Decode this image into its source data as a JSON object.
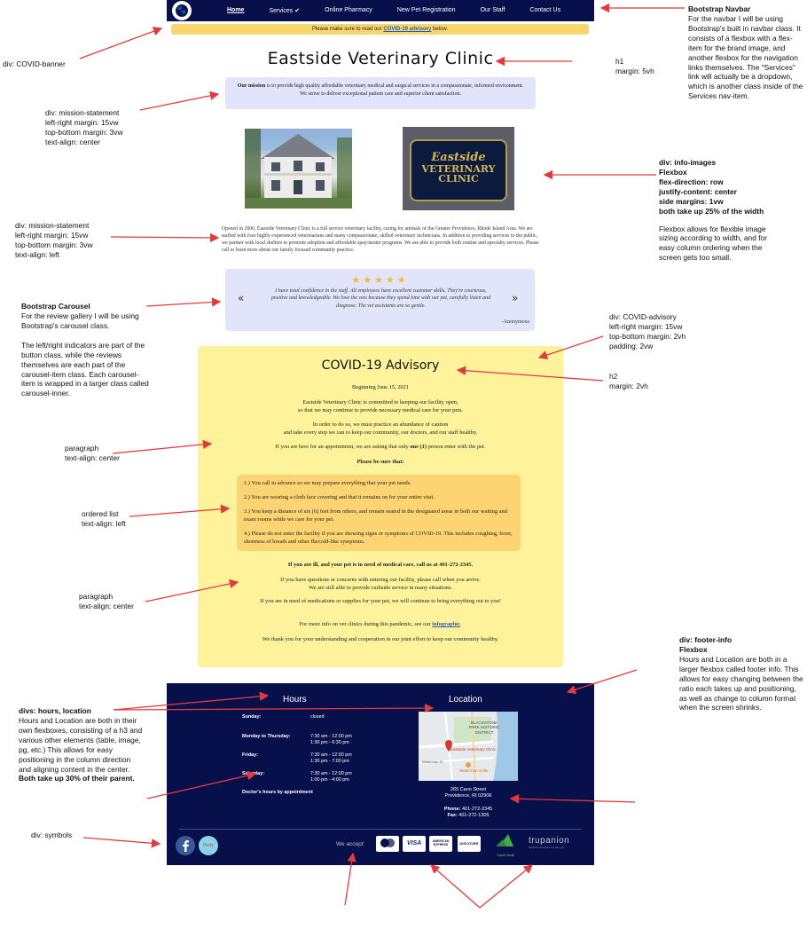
{
  "navbar": {
    "links": [
      "Home",
      "Services ✔",
      "Online Pharmacy",
      "New Pet Registration",
      "Our Staff",
      "Contact Us"
    ]
  },
  "covid_banner": {
    "text_before": "Please make sure to read our ",
    "link": "COVID-19 advisory",
    "text_after": " below."
  },
  "h1": "Eastside Veterinary Clinic",
  "mission": {
    "strong": "Our mission",
    "text": " is to provide high quality affordable veterinary medical and surgical services in a compassionate, informed environment. We strive to deliver exceptional patient care and superior client satisfaction."
  },
  "sign": {
    "line1": "Eastside",
    "line2": "VETERINARY",
    "line3": "CLINIC"
  },
  "about": "Opened in 2000, Eastside Veterinary Clinic is a full service veterinary facility, caring for animals of the Greater Providence, Rhode Island Area. We are staffed with four highly experienced veterinarians and many compassionate, skilled veterinary technicians. In addition to providing services to the public, we partner with local shelters to promote adoption and affordable spay/neuter programs. We are able to provide both routine and specialty services. Please call to learn more about our family focused  community practice.",
  "carousel": {
    "stars": "★★★★★",
    "rating": 5,
    "review": "I have total confidence in the staff. All employees have excellent customer skills. They're courteous, positive and knowledgeable. We love the vets because they spend time with our pet, carefully listen and diagnose. The vet assistants are so gentle.",
    "author": "-Anonymous",
    "prev": "«",
    "next": "»"
  },
  "advisory": {
    "h2": "COVID-19 Advisory",
    "date": "Beginning June 15, 2021",
    "p1a": "Eastside Veterinary Clinic is committed to keeping our facility open,",
    "p1b": "so that we may continue to provide necessary medical care for your pets.",
    "p2a": "In order to do so, we must practice an abundance of caution",
    "p2b": "and take every step we can to keep our community, our doctors, and our staff healthy.",
    "p3_before": "If you are here for an appointment, we are asking that only ",
    "p3_bold": "one (1)",
    "p3_after": " person enter with the pet.",
    "sure": "Please be sure that:",
    "list": [
      "1.) You call in advance so we may prepare everything that your pet needs.",
      "2.) You are wearing a cloth face covering and that it remains on for your entire visit.",
      "3.) You keep a distance of six (6) feet from others, and remain seated in the designated areas in both our waiting and exam rooms while we care for your pet.",
      "4.) Please do not enter the facility if you are showing signs or symptoms of COVID-19. This includes coughing, fever, shortness of  breath and other flu/cold-like symptoms."
    ],
    "ill": "If you are ill, and your pet is in need of medical care, call us at 401-272-2345.",
    "p5a": "If you have questions or concerns with entering our facility, please call when you arrive.",
    "p5b": "We are still able to provide curbside service in many situations.",
    "p6": "If you are in need of medications or supplies for your pet, we will continue to bring everything out to you!",
    "p7_before": "For more info on vet clinics during this pandemic, see our ",
    "p7_link": "infographic",
    "p7_after": ".",
    "p8": "We thank you for your understanding and cooperation in our joint effort to keep our community healthy."
  },
  "footer": {
    "hours_title": "Hours",
    "location_title": "Location",
    "hours": [
      {
        "day": "Sunday:",
        "time": "closed"
      },
      {
        "day": "Monday to Thursday:",
        "time": "7:30 am - 12:00 pm\n1:30 pm - 6:30 pm"
      },
      {
        "day": "Friday:",
        "time": "7:30 am - 12:00 pm\n1:30 pm - 7:00 pm"
      },
      {
        "day": "Saturday:",
        "time": "7:30 am - 12:00 pm\n1:00 pm - 4:00 pm"
      },
      {
        "day": "Doctor's hours by appointment",
        "time": ""
      }
    ],
    "map_labels": {
      "district": "BLACKSTONE\nPARK HISTORIC\nDISTRICT",
      "pin": "Eastside Veterinary Clinic",
      "other": "Waterman Grille",
      "road": "Waterman St"
    },
    "address1": "265 Cano Street",
    "address2": "Providence, RI  02906",
    "phone_label": "Phone:",
    "phone": " 401-272-2345",
    "fax_label": "Fax:",
    "fax": " 401-272-1305",
    "social_petly": "Petly",
    "we_accept": "We accept:",
    "cards": [
      "mastercard",
      "VISA",
      "AMERICAN EXPRESS",
      "DISCOVER"
    ],
    "carecredit": "CareCredit",
    "trupanion": "trupanion",
    "trupanion_sub": "Medical insurance for your pet"
  },
  "annotations": {
    "navbar_head": "Bootstrap Navbar",
    "navbar_body": "For the navbar I will be using Bootstrap's built in navbar class. It consists of a flexbox with a flex-item for the brand image, and another flexbox for the navigation links themselves. The \"Services\" link will actually be a dropdown, which is another class inside of the Services nav-item.",
    "covid_banner": "div: COVID-banner",
    "h1_a": "h1",
    "h1_b": "margin: 5vh",
    "mission1": [
      "div: mission-statement",
      "left-right margin: 15vw",
      "top-bottom margin: 3vw",
      "text-align: center"
    ],
    "info_images": [
      "div: info-images",
      "Flexbox",
      "flex-direction: row",
      "justify-content: center",
      "side margins: 1vw",
      "both take up 25% of the width"
    ],
    "info_images_body": "Flexbox allows for flexible image sizing according to width, and for easy column ordering when the screen gets too small.",
    "mission2": [
      "div: mission-statement",
      "left-right margin: 15vw",
      "top-bottom margin: 3vw",
      "text-align: left"
    ],
    "carousel_head": "Bootstrap Carousel",
    "carousel_body1": "For the review gallery I will be using Bootstrap's carousel class.",
    "carousel_body2": "The left/right indicators are part of the button class, while the reviews themselves are each part of the carousel-item class. Each carousel-item is wrapped in a larger class called carousel-inner.",
    "advisory": [
      "div: COVID-advisory",
      "left-right margin: 15vw",
      "top-bottom margin: 2vh",
      "padding: 2vw"
    ],
    "h2_a": "h2",
    "h2_b": "margin: 2vh",
    "para1": [
      "paragraph",
      "text-align: center"
    ],
    "olist": [
      "ordered list",
      "text-align: left"
    ],
    "para2": [
      "paragraph",
      "text-align: center"
    ],
    "footer_info_head": [
      "div: footer-info",
      "Flexbox"
    ],
    "footer_info_body": "Hours and Location are both in a larger flexbox called footer info. This allows for easy changing between the ratio each takes up and positioning, as well as change to column format when the screen shrinks.",
    "hours_loc_head": "divs: hours, location",
    "hours_loc_body": "Hours and Location are both in their own flexboxes, consisting of a h3 and various other elements (table, image, pg, etc.) This allows for easy positioning in the column direction and aligning content in the center.",
    "hours_loc_bold": "Both take up 30% of their parent.",
    "symbols": "div: symbols"
  }
}
